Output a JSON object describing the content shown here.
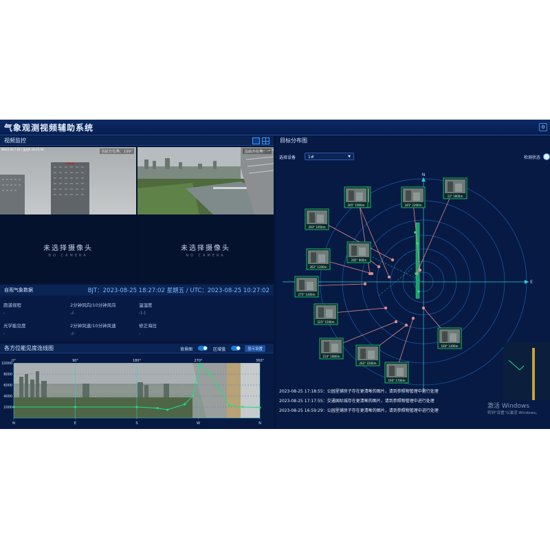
{
  "app": {
    "title": "气象观测视频辅助系统"
  },
  "video": {
    "panel_title": "视频监控",
    "cells": [
      {
        "azimuth_label": "当前方位角：199°",
        "osd": "ND24 40.7.02 / 监控A 18:25:58"
      },
      {
        "azimuth_label": "当前方位角：-°"
      },
      {
        "no_camera": "未选择摄像头",
        "no_camera_sub": "NO CAMERA"
      },
      {
        "no_camera": "未选择摄像头",
        "no_camera_sub": "NO CAMERA"
      }
    ]
  },
  "weather": {
    "title": "自观气象数据",
    "time": "BJT：2023-08-25 18:27:02 星期五 / UTC：2023-08-25 10:27:02",
    "items": [
      {
        "label": "跑道视程",
        "value": "-"
      },
      {
        "label": "2分钟风向/10分钟风向",
        "value": "-/-"
      },
      {
        "label": "温湿度",
        "value": "-(-)"
      },
      {
        "label": "光学能见度",
        "value": "-"
      },
      {
        "label": "2分钟风速/10分钟风速",
        "value": "-/-"
      },
      {
        "label": "修正海压",
        "value": "-"
      }
    ]
  },
  "wind_panel": {
    "title": "各方位能见度连线图",
    "bg_label": "背景图",
    "zone_label": "区域值",
    "settings_btn": "显示设置"
  },
  "target_panel": {
    "title": "目标分布图",
    "device_label": "选择设备",
    "device_value": "1#",
    "detect_label": "检测状态"
  },
  "logs": [
    "2023-08-25 17:18:55：公园里铺房子存在更清晰的图片，请到参照物管理中进行处理",
    "2023-08-25 17:17:55：交通国际城存在更清晰的图片，请到参照物管理中进行处理",
    "2023-08-25 16:59:29：公园里铺房子存在更清晰的图片，请到参照物管理中进行处理"
  ],
  "watermark": {
    "line1": "激活 Windows",
    "line2": "转到\"设置\"以激活 Windows。"
  },
  "chart_data": {
    "type": "line",
    "xlabel": "",
    "ylabel": "",
    "x_ticks": [
      "0°",
      "90°",
      "180°",
      "270°",
      "360°"
    ],
    "x_dir": [
      "N",
      "E",
      "S",
      "W",
      "N"
    ],
    "y_ticks": [
      "10000",
      "8000",
      "6000",
      "4000",
      "2000"
    ],
    "ylim": [
      0,
      10000
    ],
    "xlim": [
      0,
      360
    ],
    "series": [
      {
        "name": "",
        "color": "#22e07a",
        "points": [
          [
            0,
            2000
          ],
          [
            90,
            2000
          ],
          [
            180,
            2000
          ],
          [
            210,
            1800
          ],
          [
            225,
            1500
          ],
          [
            250,
            2500
          ],
          [
            262,
            4000
          ],
          [
            272,
            9800
          ],
          [
            285,
            8200
          ],
          [
            300,
            5500
          ],
          [
            315,
            2300
          ],
          [
            335,
            2000
          ],
          [
            360,
            1900
          ]
        ]
      }
    ]
  },
  "radar": {
    "directions": [
      "N",
      "E",
      "S",
      "W"
    ],
    "targets": [
      {
        "label": "242° 1800m"
      },
      {
        "label": "305° 1900m"
      },
      {
        "label": "345° 2200m"
      },
      {
        "label": "12° 1800m"
      },
      {
        "label": "293° 1950m"
      },
      {
        "label": "285° 900m"
      },
      {
        "label": "262° 1200m"
      },
      {
        "label": "275° 1400m"
      },
      {
        "label": "225° 1500m"
      },
      {
        "label": "210° 1800m"
      },
      {
        "label": "202° 2200m"
      },
      {
        "label": "190° 1700m"
      },
      {
        "label": "160° 1400m"
      }
    ]
  }
}
